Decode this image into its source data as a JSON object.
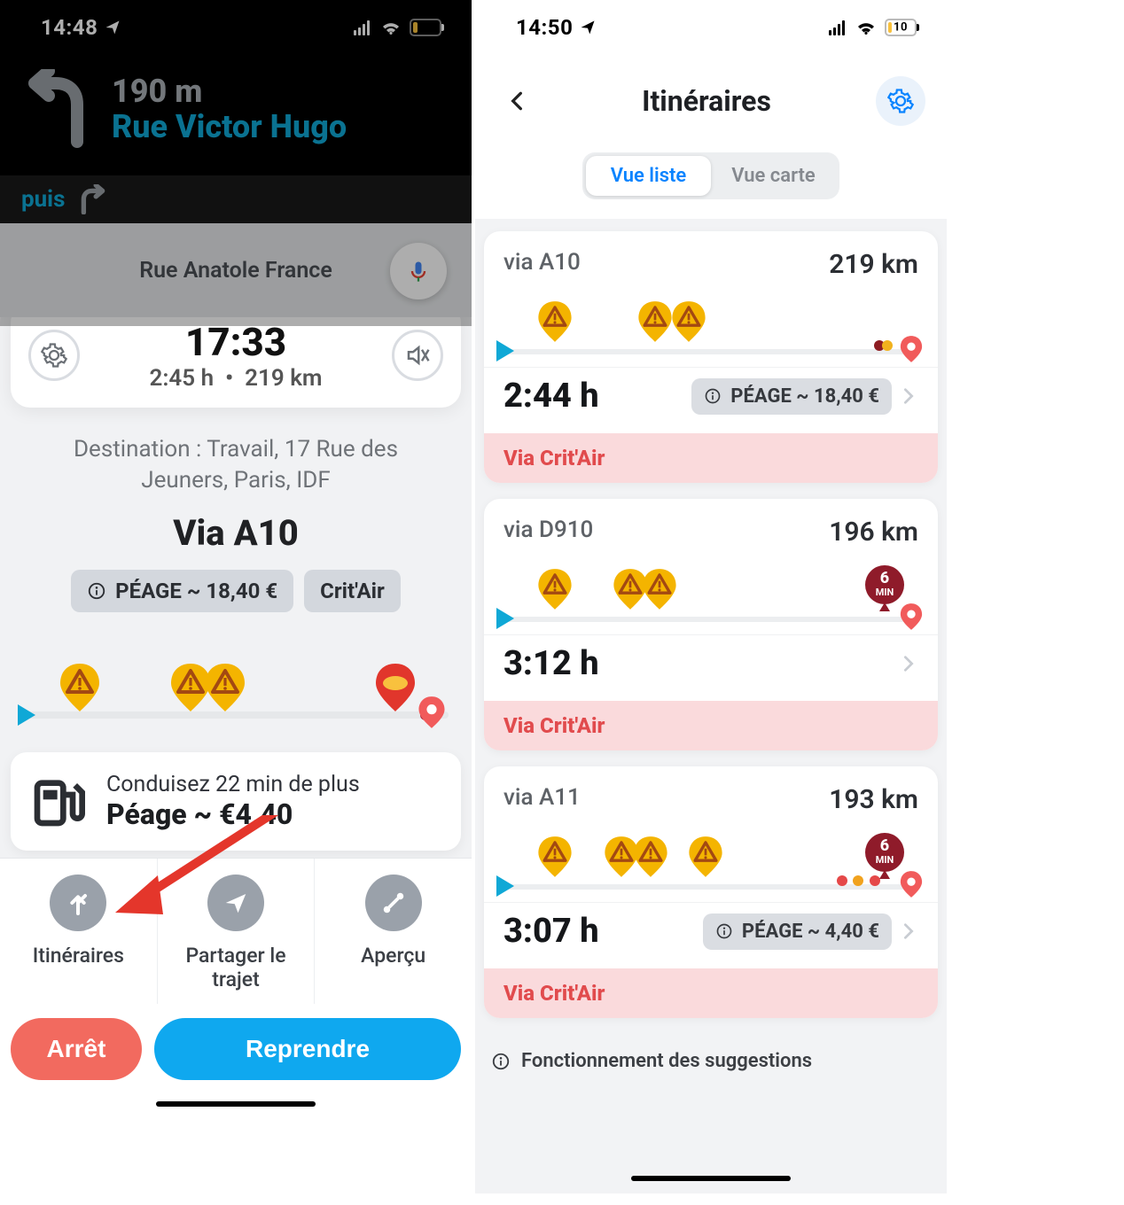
{
  "phone1": {
    "status": {
      "time": "14:48",
      "battery": "11"
    },
    "nav": {
      "distance": "190 m",
      "street": "Rue Victor Hugo",
      "then_label": "puis"
    },
    "map": {
      "street_label": "Rue Anatole France"
    },
    "eta": {
      "arrival": "17:33",
      "duration": "2:45 h",
      "distance": "219 km"
    },
    "destination": {
      "label": "Destination : Travail, 17 Rue des Jeuners, Paris, IDF",
      "via": "Via A10",
      "toll": "PÉAGE ~ 18,40 €",
      "crit": "Crit'Air"
    },
    "gas": {
      "line1": "Conduisez 22 min de plus",
      "line2": "Péage ~ €4.40"
    },
    "actions": {
      "routes": "Itinéraires",
      "share": "Partager le trajet",
      "overview": "Aperçu"
    },
    "buttons": {
      "stop": "Arrêt",
      "resume": "Reprendre"
    }
  },
  "phone2": {
    "status": {
      "time": "14:50",
      "battery": "10"
    },
    "title": "Itinéraires",
    "segment": {
      "list": "Vue liste",
      "map": "Vue carte"
    },
    "routes": [
      {
        "via": "via A10",
        "distance": "219 km",
        "time": "2:44 h",
        "toll": "PÉAGE ~ 18,40 €",
        "crit": "Via Crit'Air",
        "hazards": [
          8,
          32,
          40
        ],
        "delay": null,
        "dots": [
          {
            "x": 89,
            "c": "#8d1d22"
          },
          {
            "x": 90.8,
            "c": "#f1b21e"
          }
        ]
      },
      {
        "via": "via D910",
        "distance": "196 km",
        "time": "3:12 h",
        "toll": null,
        "crit": "Via Crit'Air",
        "hazards": [
          8,
          26,
          33
        ],
        "delay": {
          "x": 92,
          "label": "6",
          "unit": "MIN"
        },
        "dots": []
      },
      {
        "via": "via A11",
        "distance": "193 km",
        "time": "3:07 h",
        "toll": "PÉAGE ~ 4,40 €",
        "crit": "Via Crit'Air",
        "hazards": [
          8,
          24,
          31,
          44
        ],
        "delay": {
          "x": 92,
          "label": "6",
          "unit": "MIN"
        },
        "dots": [
          {
            "x": 80,
            "c": "#e54848"
          },
          {
            "x": 84,
            "c": "#f1a21e"
          },
          {
            "x": 88,
            "c": "#e54848"
          }
        ]
      }
    ],
    "how": "Fonctionnement des suggestions"
  }
}
